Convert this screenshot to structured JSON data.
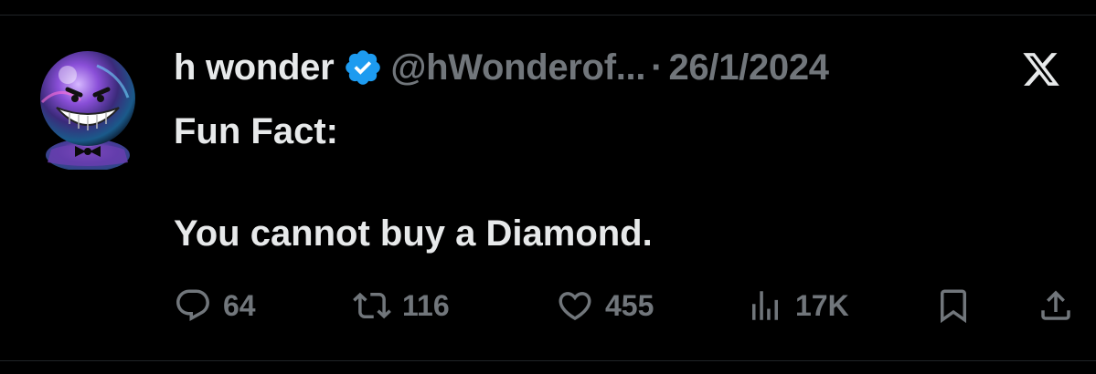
{
  "tweet": {
    "display_name": "h wonder",
    "verified_icon": "verified-badge-icon",
    "handle": "@hWonderof...",
    "separator": "·",
    "date": "26/1/2024",
    "text_lines": [
      "Fun Fact:",
      "",
      "You cannot buy a Diamond."
    ]
  },
  "actions": {
    "replies": "64",
    "retweets": "116",
    "likes": "455",
    "views": "17K"
  },
  "icons": {
    "reply": "reply-icon",
    "retweet": "retweet-icon",
    "like": "heart-icon",
    "views": "views-icon",
    "bookmark": "bookmark-icon",
    "share": "share-icon",
    "brand": "x-logo-icon"
  },
  "colors": {
    "background": "#000000",
    "text": "#e7e9ea",
    "secondary": "#71767b",
    "verified": "#1d9bf0"
  }
}
